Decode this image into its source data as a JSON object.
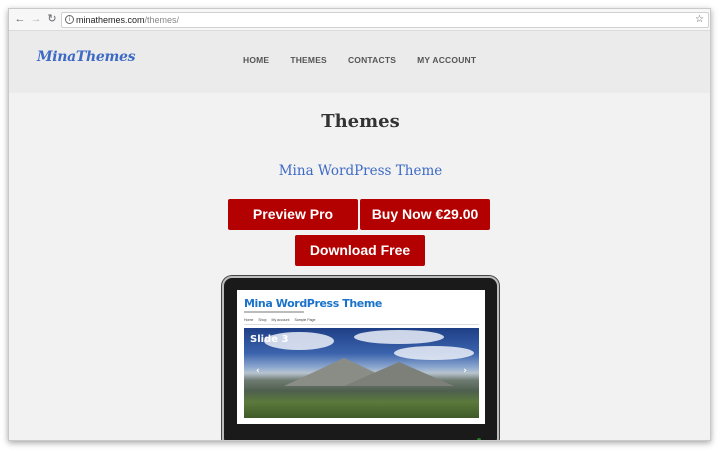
{
  "browser": {
    "url_host": "minathemes.com",
    "url_path": "/themes/"
  },
  "site": {
    "logo": "MinaThemes",
    "menu": [
      {
        "label": "HOME"
      },
      {
        "label": "THEMES"
      },
      {
        "label": "CONTACTS"
      },
      {
        "label": "MY ACCOUNT"
      }
    ]
  },
  "main": {
    "title": "Themes",
    "theme_name": "Mina WordPress Theme",
    "buttons": {
      "preview": "Preview Pro",
      "buy": "Buy Now €29.00",
      "download": "Download Free"
    },
    "preview_screen": {
      "title": "Mina WordPress Theme",
      "nav": [
        "Home",
        "Shop",
        "My account",
        "Sample Page"
      ],
      "slide_label": "Slide 3"
    }
  },
  "colors": {
    "accent_red": "#b30000",
    "link_blue": "#3d6ac4"
  }
}
